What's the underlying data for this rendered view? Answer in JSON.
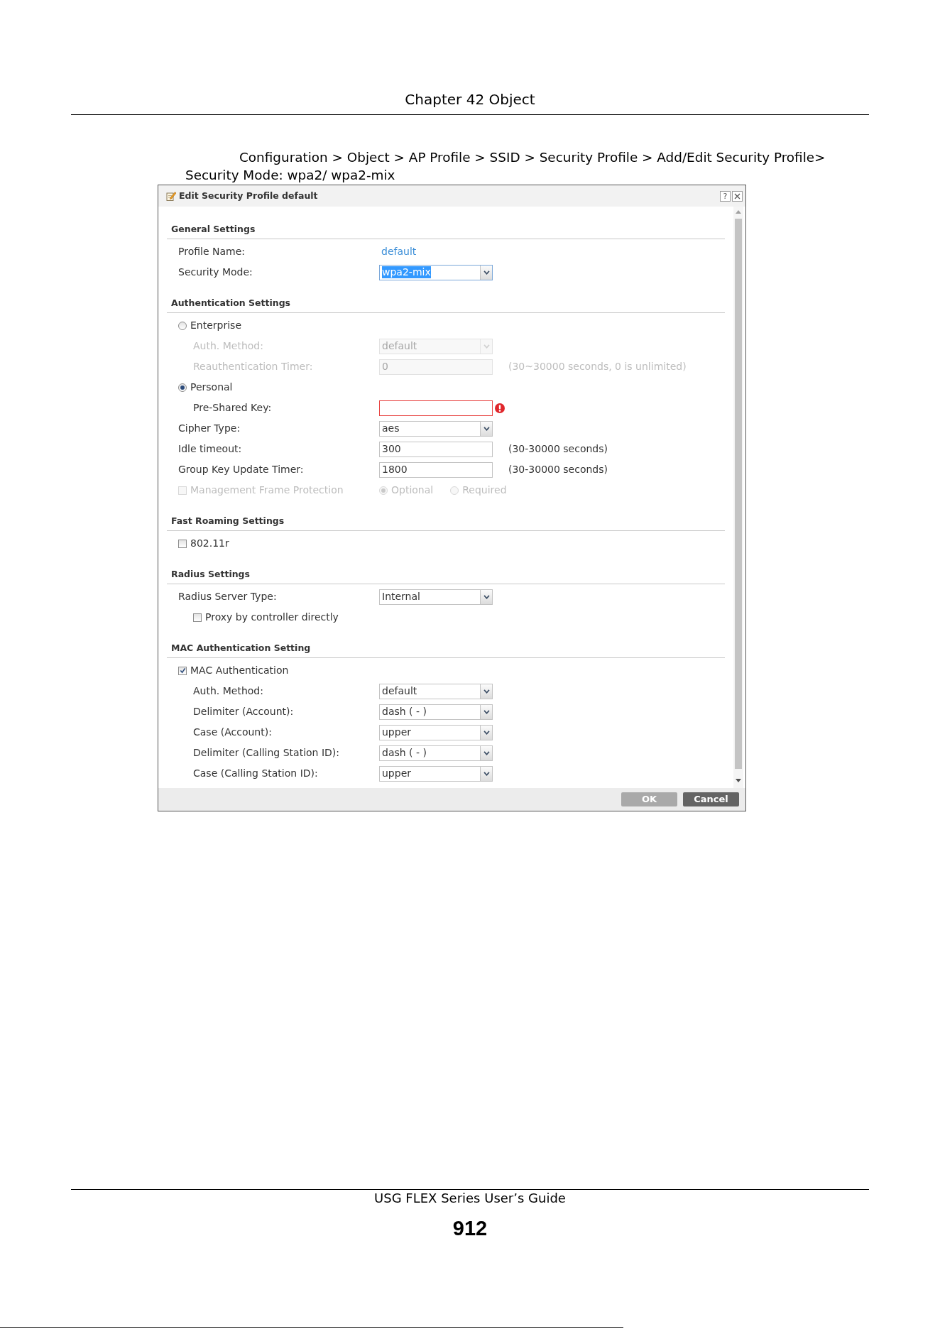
{
  "header": {
    "title": "Chapter 42 Object"
  },
  "caption": "Configuration > Object > AP Profile > SSID > Security Profile > Add/Edit Security Profile> Security Mode: wpa2/ wpa2-mix",
  "dialog": {
    "title": "Edit Security Profile default",
    "help_label": "?",
    "sections": [
      {
        "title": "General Settings",
        "rows": [
          {
            "kind": "text",
            "label": "Profile Name:",
            "value": "default"
          },
          {
            "kind": "select",
            "label": "Security Mode:",
            "value": "wpa2-mix",
            "disabled": false,
            "highlighted": true
          }
        ]
      },
      {
        "title": "Authentication Settings",
        "rows": [
          {
            "kind": "radio",
            "label": "Enterprise",
            "selected": false,
            "disabled": false,
            "children": [
              {
                "kind": "select",
                "label": "Auth. Method:",
                "value": "default",
                "disabled": true,
                "highlighted": false
              },
              {
                "kind": "input",
                "label": "Reauthentication Timer:",
                "value": "0",
                "hint": "(30~30000 seconds, 0 is unlimited)",
                "disabled": true,
                "error": false
              }
            ]
          },
          {
            "kind": "radio",
            "label": "Personal",
            "selected": true,
            "disabled": false,
            "children": [
              {
                "kind": "input",
                "label": "Pre-Shared Key:",
                "error": true
              }
            ]
          },
          {
            "kind": "select",
            "label": "Cipher Type:",
            "value": "aes",
            "disabled": false,
            "highlighted": false
          },
          {
            "kind": "input",
            "label": "Idle timeout:",
            "value": "300",
            "hint": "(30-30000 seconds)",
            "disabled": false,
            "error": false
          },
          {
            "kind": "input",
            "label": "Group Key Update Timer:",
            "value": "1800",
            "hint": "(30-30000 seconds)",
            "disabled": false,
            "error": false
          },
          {
            "kind": "checkbox",
            "label": "Management Frame Protection",
            "checked": false,
            "disabled": true,
            "options": [
              {
                "label": "Optional",
                "selected": true,
                "disabled": true
              },
              {
                "label": "Required",
                "selected": false,
                "disabled": true
              }
            ]
          }
        ]
      },
      {
        "title": "Fast Roaming Settings",
        "rows": [
          {
            "kind": "checkbox",
            "label": "802.11r",
            "checked": false,
            "disabled": false
          }
        ]
      },
      {
        "title": "Radius Settings",
        "rows": [
          {
            "kind": "select",
            "label": "Radius Server Type:",
            "value": "Internal",
            "disabled": false,
            "highlighted": false,
            "children": [
              {
                "kind": "checkbox",
                "label": "Proxy by controller directly",
                "checked": false,
                "disabled": false
              }
            ]
          }
        ]
      },
      {
        "title": "MAC Authentication Setting",
        "rows": [
          {
            "kind": "checkbox",
            "label": "MAC Authentication",
            "checked": true,
            "disabled": false,
            "children": [
              {
                "kind": "select",
                "label": "Auth. Method:",
                "value": "default",
                "disabled": false,
                "highlighted": false
              },
              {
                "kind": "select",
                "label": "Delimiter (Account):",
                "value": "dash ( - )",
                "disabled": false,
                "highlighted": false
              },
              {
                "kind": "select",
                "label": "Case (Account):",
                "value": "upper",
                "disabled": false,
                "highlighted": false
              },
              {
                "kind": "select",
                "label": "Delimiter (Calling Station ID):",
                "value": "dash ( - )",
                "disabled": false,
                "highlighted": false
              },
              {
                "kind": "select",
                "label": "Case (Calling Station ID):",
                "value": "upper",
                "disabled": false,
                "highlighted": false
              }
            ]
          }
        ]
      }
    ],
    "buttons": [
      {
        "label": "OK",
        "disabled": true
      },
      {
        "label": "Cancel",
        "disabled": false
      }
    ]
  },
  "footer": {
    "title": "USG FLEX Series User’s Guide",
    "page_number": "912"
  }
}
